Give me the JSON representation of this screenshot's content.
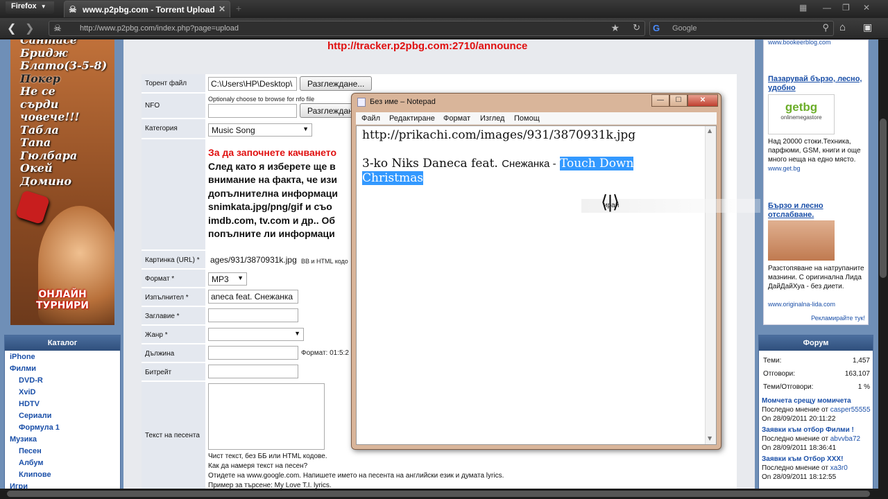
{
  "browser": {
    "app_button": "Firefox",
    "tab_title": "www.p2pbg.com - Torrent Upload",
    "url": "http://www.p2pbg.com/index.php?page=upload",
    "search_placeholder": "Google"
  },
  "banner": {
    "words": [
      "Сантасе",
      "Бридж",
      "Блато(3-5-8)",
      "Покер",
      "Не се",
      "сърди",
      "човече!!!",
      "Табла",
      "Тапа",
      "Гюлбара",
      "Окей",
      "Домино"
    ],
    "footer": "ОНЛАЙН ТУРНИРИ"
  },
  "catalog": {
    "title": "Каталог",
    "items": [
      {
        "label": "iPhone",
        "sub": false
      },
      {
        "label": "Филми",
        "sub": false
      },
      {
        "label": "DVD-R",
        "sub": true
      },
      {
        "label": "XviD",
        "sub": true
      },
      {
        "label": "HDTV",
        "sub": true
      },
      {
        "label": "Сериали",
        "sub": true
      },
      {
        "label": "Формула 1",
        "sub": true
      },
      {
        "label": "Музика",
        "sub": false
      },
      {
        "label": "Песен",
        "sub": true
      },
      {
        "label": "Албум",
        "sub": true
      },
      {
        "label": "Клипове",
        "sub": true
      },
      {
        "label": "Игри",
        "sub": false
      }
    ]
  },
  "main": {
    "announce": "http://tracker.p2pbg.com:2710/announce",
    "form": {
      "torrent_label": "Торент файл",
      "torrent_value": "C:\\Users\\HP\\Desktop\\",
      "browse_label": "Разглеждане...",
      "nfo_label": "NFO",
      "nfo_hint": "Optionaly choose to browse for nfo file",
      "nfo_browse_label": "Разглеждане",
      "category_label": "Категория",
      "category_value": "Music Song",
      "para_red": "За да започнете качването",
      "para_lines": [
        "След като я изберете ще в",
        "внимание на факта, че изи",
        "допълнителна информаци",
        "snimkata.jpg/png/gif и съо",
        "imdb.com, tv.com и др.. Об",
        "попълните ли информаци"
      ],
      "image_label": "Картинка (URL) *",
      "image_value": "ages/931/3870931k.jpg",
      "image_hint": "BB и HTML кодо",
      "format_label": "Формат *",
      "format_value": "MP3",
      "artist_label": "Изпълнител *",
      "artist_value": "aneca feat. Снежанка",
      "title_label": "Заглавие *",
      "genre_label": "Жанр *",
      "duration_label": "Дължина",
      "duration_hint": "Формат: 01:5:2",
      "bitrate_label": "Битрейт",
      "lyrics_label": "Текст на песента",
      "hints": [
        "Чист текст, без ББ или HTML кодове.",
        "Как да намеря текст на песен?",
        "Отидете на www.google.com. Напишете името на песента на английски език и думата lyrics.",
        "Пример за търсене: My Love T.I. lyrics."
      ]
    }
  },
  "right_ads": {
    "top_url": "www.bookeerblog.com",
    "ad1_title": "Пазарувай бързо, лесно, удобно",
    "ad1_logo": "getbg",
    "ad1_logo_tag": "onlinemegastore",
    "ad1_text": "Над 20000 стоки.Техника, парфюми, GSM, книги и още много неща на едно място.",
    "ad1_url": "www.get.bg",
    "ad2_title": "Бързо и лесно отслабване.",
    "ad2_text": "Разстопяване на натрупаните мазнини. С оригинална Лида ДайДайХуа - без диети.",
    "ad2_url": "www.originalna-lida.com",
    "report": "Рекламирайте тук!"
  },
  "forum": {
    "title": "Форум",
    "stats": [
      {
        "label": "Теми:",
        "value": "1,457"
      },
      {
        "label": "Отговори:",
        "value": "163,107"
      },
      {
        "label": "Теми/Отговори:",
        "value": "1 %"
      }
    ],
    "posts": [
      {
        "title": "Момчета срещу момичета",
        "last": "Последно мнение от",
        "user": "casper55555",
        "date": "On 28/09/2011 20:11:22"
      },
      {
        "title": "Заявки към отбор Филми !",
        "last": "Последно мнение от",
        "user": "abvvba72",
        "date": "On 28/09/2011 18:36:41"
      },
      {
        "title": "Заявки към Отбор XXX!",
        "last": "Последно мнение от",
        "user": "xa3r0",
        "date": "On 28/09/2011 18:12:55"
      }
    ]
  },
  "notepad": {
    "title": "Без име – Notepad",
    "menu": [
      "Файл",
      "Редактиране",
      "Формат",
      "Изглед",
      "Помощ"
    ],
    "line1": "http://prikachi.com/images/931/3870931k.jpg",
    "line2_plain": "3-ko Niks Daneca feat.",
    "line2_cyr": "Снежанка -",
    "line2_selected": "Touch Down",
    "line3_selected": "Christmas"
  },
  "tooltip": {
    "text": "ирай"
  }
}
